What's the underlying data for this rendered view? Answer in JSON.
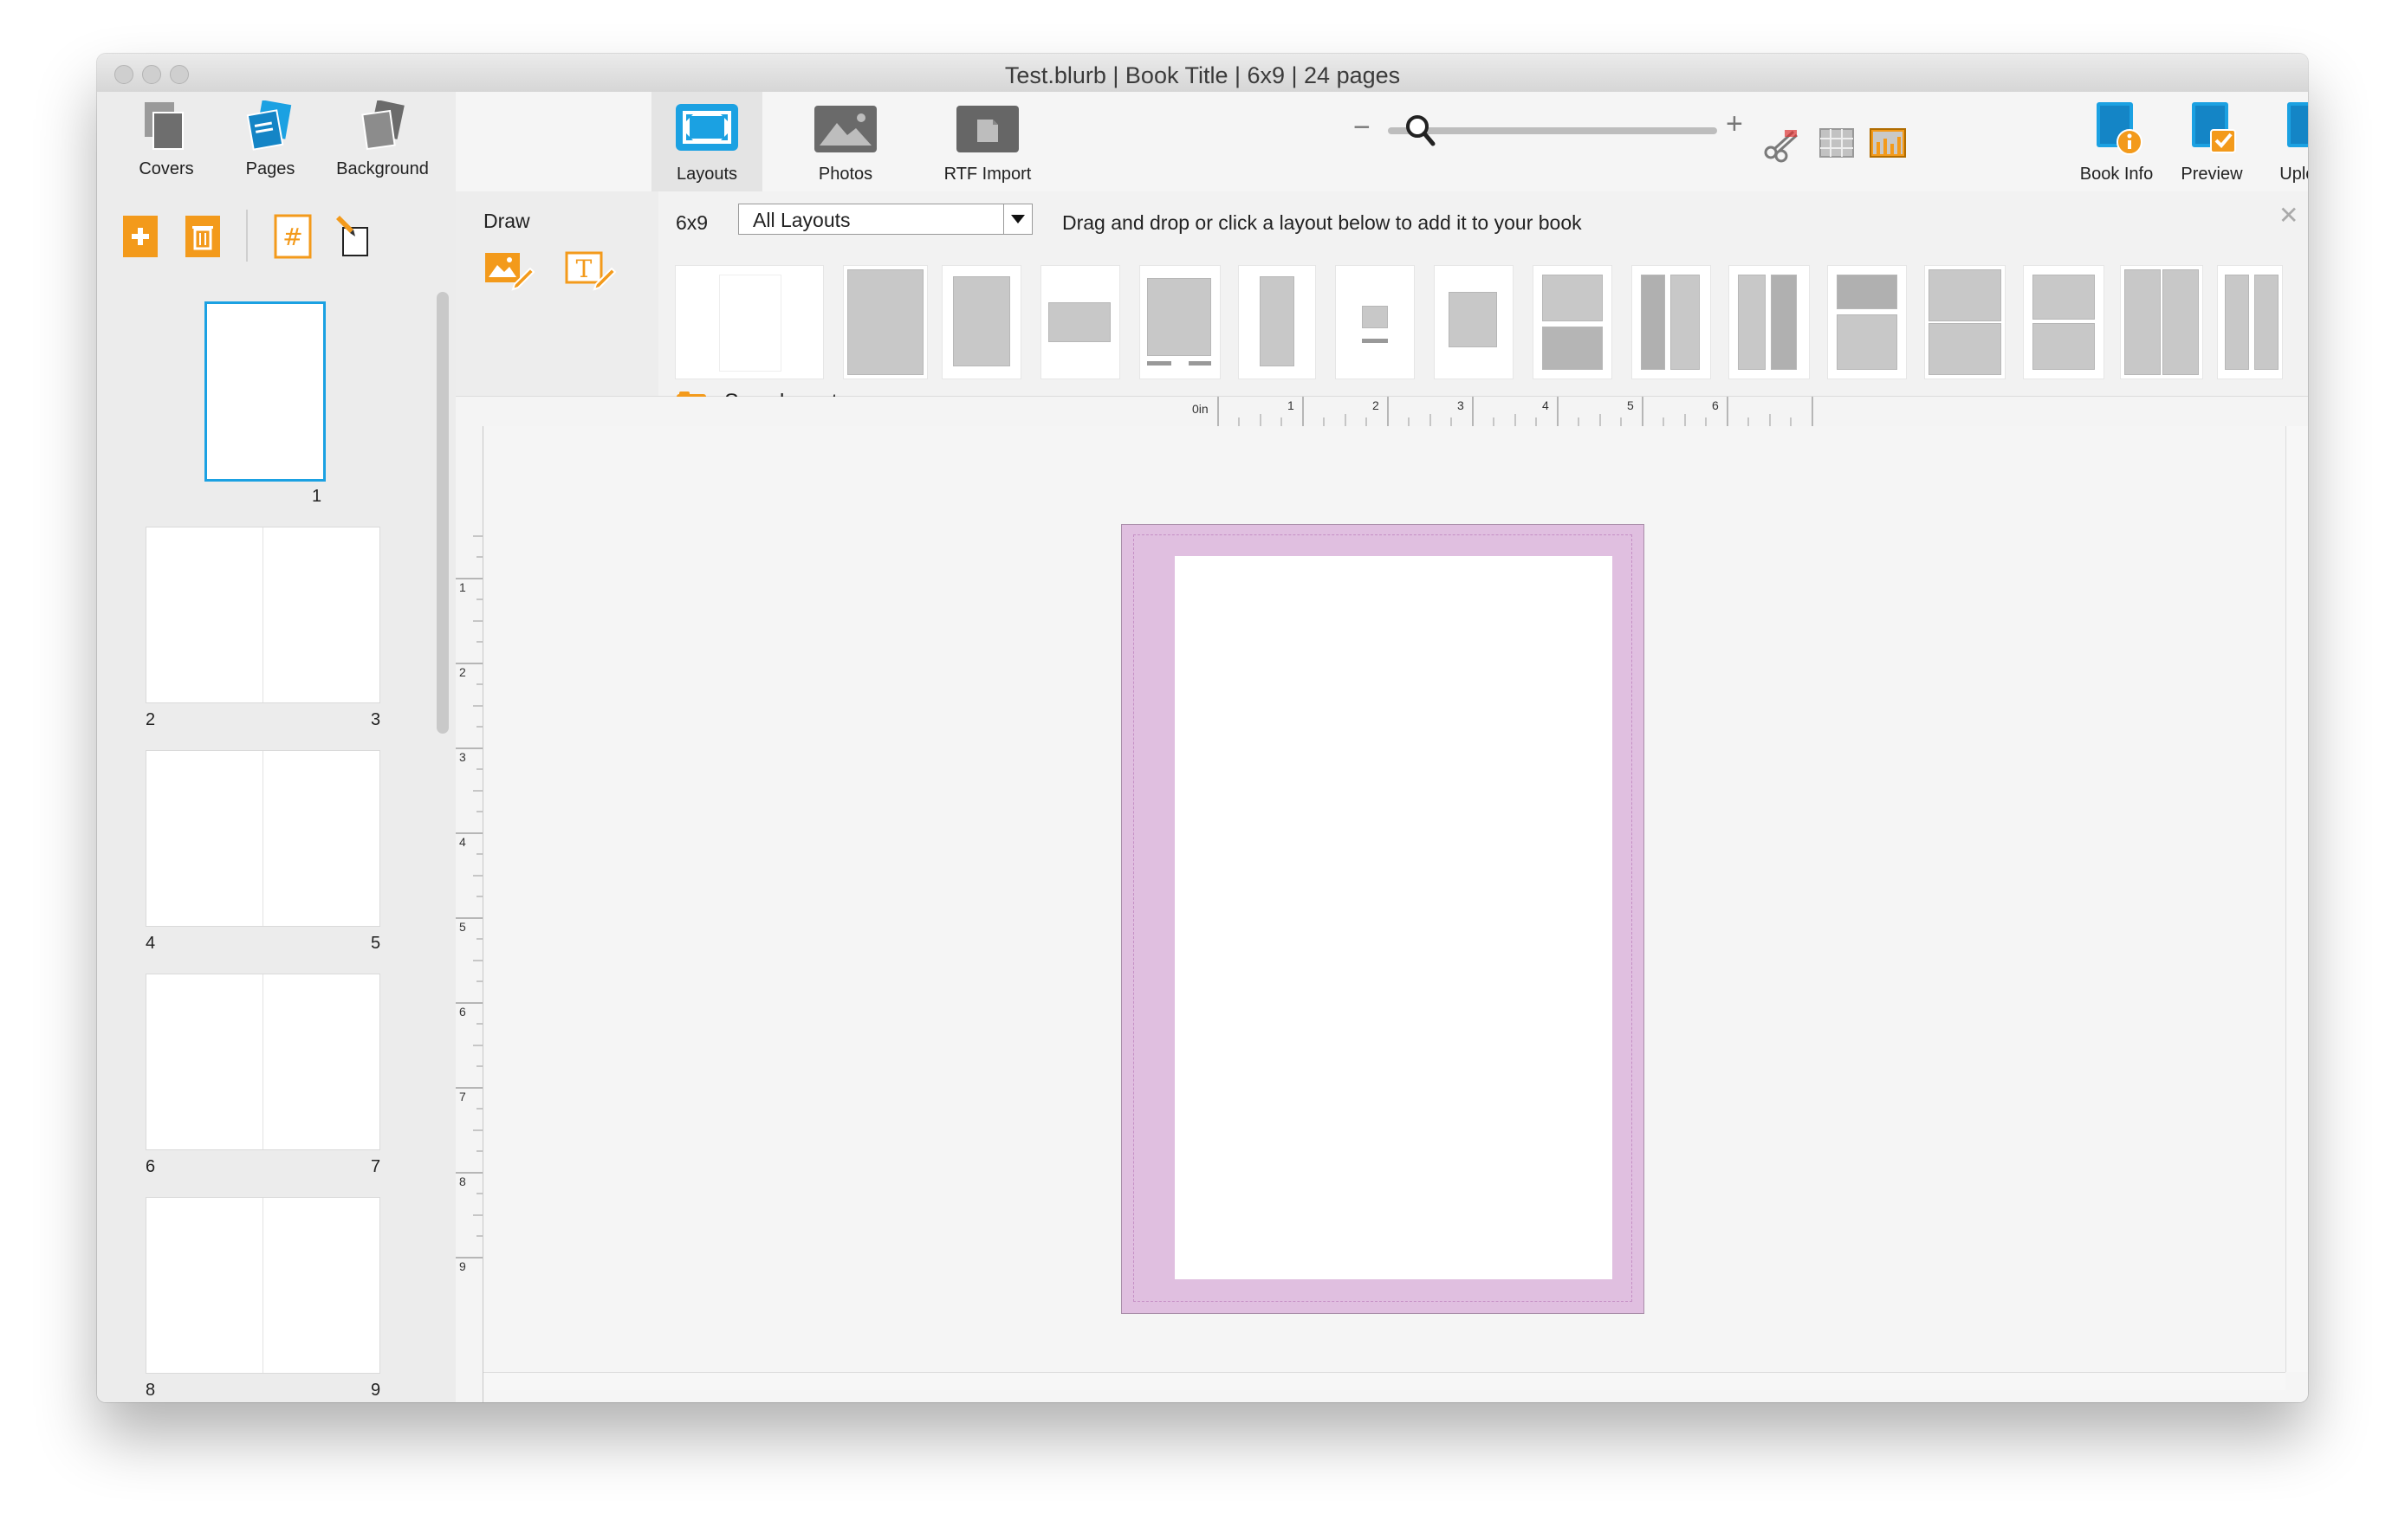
{
  "window": {
    "title": "Test.blurb | Book Title | 6x9 | 24 pages"
  },
  "left_toolbar": {
    "covers": "Covers",
    "pages": "Pages",
    "background": "Background"
  },
  "tabs": [
    {
      "label": "Layouts",
      "active": true
    },
    {
      "label": "Photos",
      "active": false
    },
    {
      "label": "RTF Import",
      "active": false
    }
  ],
  "right_buttons": {
    "book_info": "Book Info",
    "preview": "Preview",
    "upload": "Upload"
  },
  "zoom": {
    "minus": "−",
    "plus": "+"
  },
  "draw": {
    "label": "Draw"
  },
  "layout_bar": {
    "size": "6x9",
    "filter": "All Layouts",
    "hint": "Drag and drop or click a layout below to add it to your book",
    "save_layout": "Save layout"
  },
  "pages": [
    {
      "left": "1"
    },
    {
      "left": "2",
      "right": "3"
    },
    {
      "left": "4",
      "right": "5"
    },
    {
      "left": "6",
      "right": "7"
    },
    {
      "left": "8",
      "right": "9"
    }
  ],
  "ruler": {
    "h_labels": [
      "0in",
      "1",
      "2",
      "3",
      "4",
      "5",
      "6"
    ],
    "v_labels": [
      "1",
      "2",
      "3",
      "4",
      "5",
      "6",
      "7",
      "8",
      "9"
    ]
  },
  "colors": {
    "accent_orange": "#f39a1b",
    "accent_blue": "#1ba1e2",
    "bleed_pink": "#e0bfe0"
  }
}
